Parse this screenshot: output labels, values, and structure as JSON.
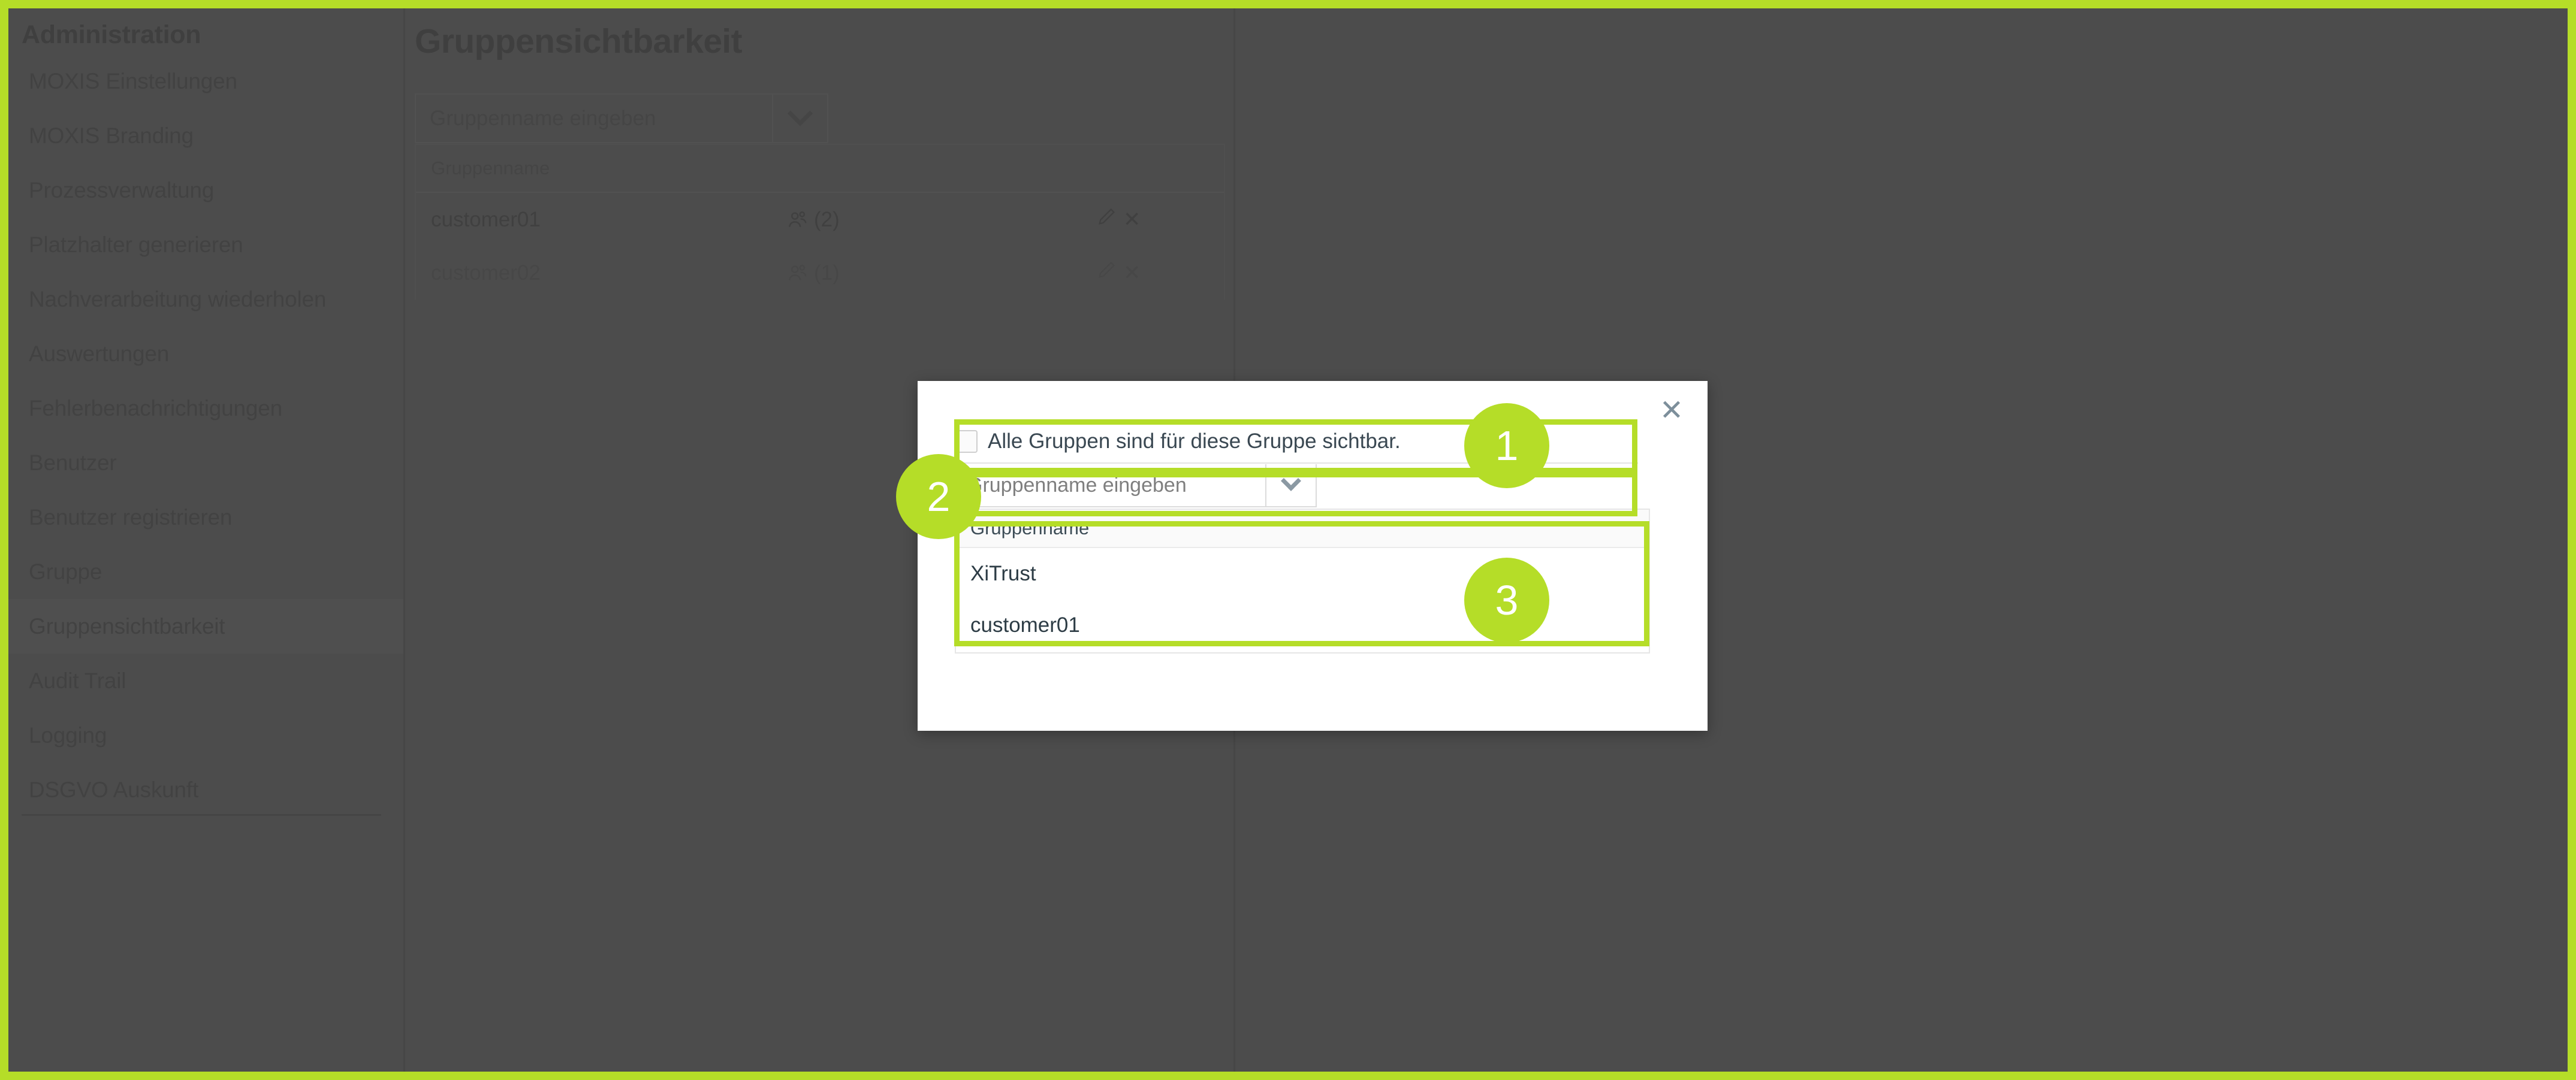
{
  "theme": {
    "accent_green": "#b5dd28",
    "app_background": "#4c4c4c",
    "modal_background": "#ffffff",
    "sidebar_active_background": "#555555"
  },
  "sidebar": {
    "title": "Administration",
    "items": [
      {
        "label": "MOXIS Einstellungen",
        "active": false
      },
      {
        "label": "MOXIS Branding",
        "active": false
      },
      {
        "label": "Prozessverwaltung",
        "active": false
      },
      {
        "label": "Platzhalter generieren",
        "active": false
      },
      {
        "label": "Nachverarbeitung wiederholen",
        "active": false
      },
      {
        "label": "Auswertungen",
        "active": false
      },
      {
        "label": "Fehlerbenachrichtigungen",
        "active": false
      },
      {
        "label": "Benutzer",
        "active": false
      },
      {
        "label": "Benutzer registrieren",
        "active": false
      },
      {
        "label": "Gruppe",
        "active": false
      },
      {
        "label": "Gruppensichtbarkeit",
        "active": true
      },
      {
        "label": "Audit Trail",
        "active": false
      },
      {
        "label": "Logging",
        "active": false
      },
      {
        "label": "DSGVO Auskunft",
        "active": false
      }
    ]
  },
  "main": {
    "page_title": "Gruppensichtbarkeit",
    "search": {
      "placeholder": "Gruppenname eingeben",
      "value": "",
      "toggle_icon": "chevron-down-icon"
    },
    "table": {
      "header": "Gruppenname",
      "rows": [
        {
          "name": "customer01",
          "members_icon": "users-icon",
          "members_count": "(2)",
          "edit_icon": "pencil-icon",
          "delete_icon": "close-icon"
        },
        {
          "name": "customer02",
          "members_icon": "users-icon",
          "members_count": "(1)",
          "edit_icon": "pencil-icon",
          "delete_icon": "close-icon"
        }
      ]
    }
  },
  "modal": {
    "close_icon": "close-icon",
    "close_label": "✕",
    "checkbox": {
      "label": "Alle Gruppen sind für diese Gruppe sichtbar.",
      "checked": false
    },
    "search": {
      "placeholder": "Gruppenname eingeben",
      "value": "",
      "toggle_icon": "chevron-down-icon"
    },
    "table": {
      "header": "Gruppenname",
      "rows": [
        {
          "name": "XiTrust"
        },
        {
          "name": "customer01"
        }
      ]
    }
  },
  "annotations": {
    "badges": [
      {
        "number": "1"
      },
      {
        "number": "2"
      },
      {
        "number": "3"
      }
    ]
  }
}
